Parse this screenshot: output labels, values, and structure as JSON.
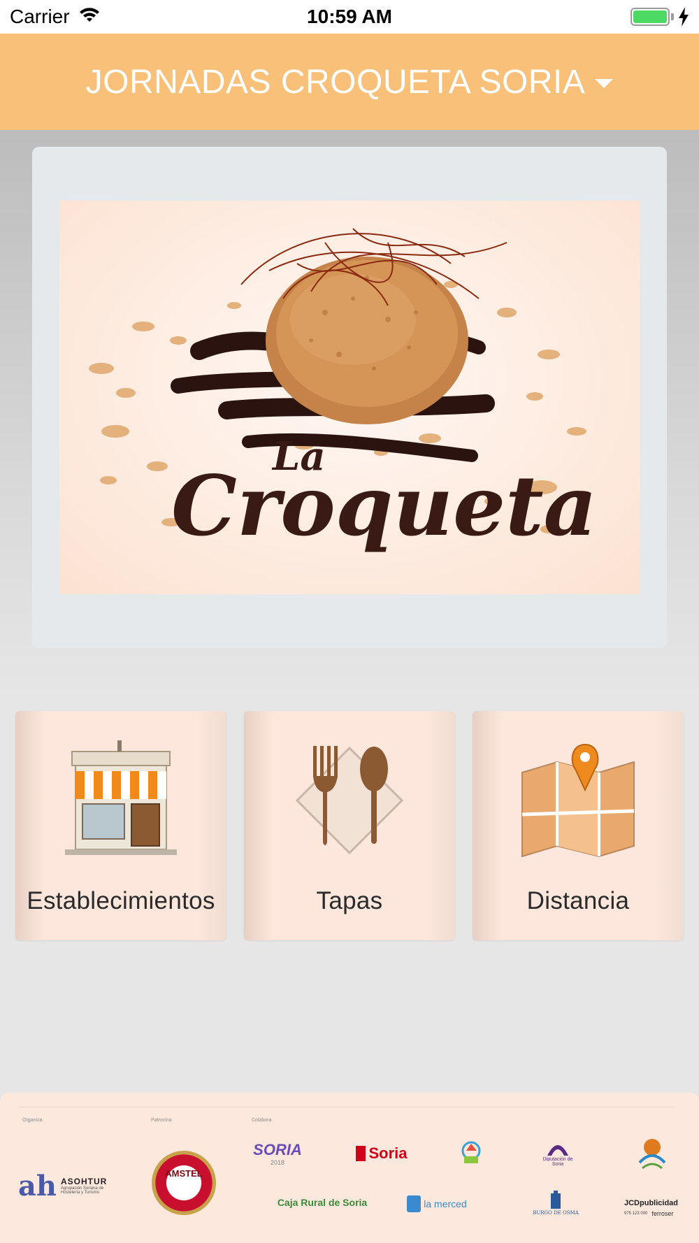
{
  "status_bar": {
    "carrier": "Carrier",
    "time": "10:59 AM",
    "wifi_icon": "wifi-icon",
    "battery_icon": "battery-charging-icon"
  },
  "nav": {
    "title": "JORNADAS CROQUETA SORIA",
    "dropdown_icon": "caret-down-icon"
  },
  "banner": {
    "title_small": "La",
    "title_large": "Croqueta"
  },
  "tiles": [
    {
      "label": "Establecimientos",
      "icon": "storefront-icon"
    },
    {
      "label": "Tapas",
      "icon": "fork-spoon-icon"
    },
    {
      "label": "Distancia",
      "icon": "map-pin-icon"
    }
  ],
  "sponsors": {
    "section_labels": [
      "Organiza",
      "Patrocina",
      "Colabora"
    ],
    "logos": {
      "asohtur": "ASOHTUR",
      "asohtur_sub": "Agrupación Soriana de Hostelería y Turismo",
      "amstel": "AMSTEL",
      "amstel_sub": "CERVEZA",
      "soria_gastro": "SORIA",
      "soria_gastro_sub": "2018",
      "ayto_soria": "Soria",
      "diputacion": "Diputación de Soria",
      "caja_rural": "Caja Rural de Soria",
      "la_merced": "la merced",
      "burgo_osma": "BURGO DE OSMA",
      "jcd": "JCDpublicidad",
      "jcd_sub": "975 123 000",
      "ferroser": "ferroser"
    }
  },
  "colors": {
    "nav_background": "#f8c078",
    "tile_background": "#fde7dc",
    "banner_card": "#e6e9ec",
    "footer_background": "#fde8dd",
    "brand_dark": "#3a1a14"
  }
}
